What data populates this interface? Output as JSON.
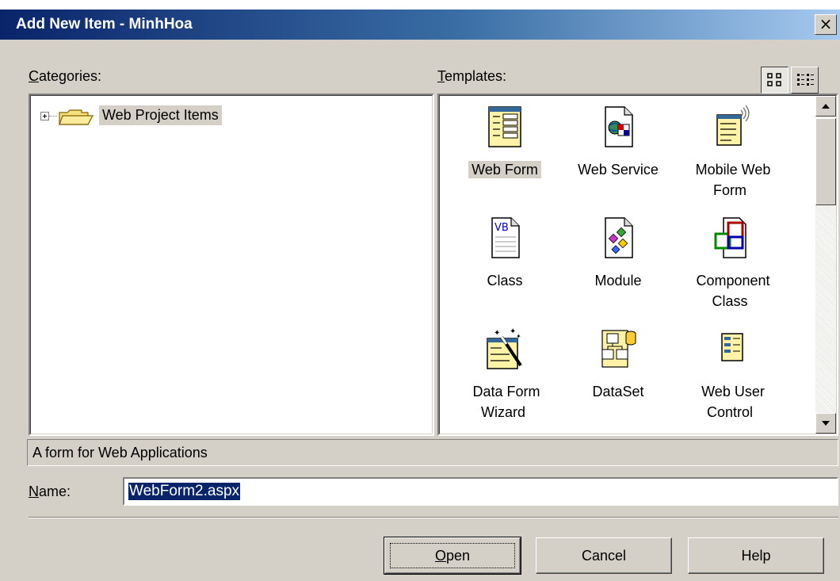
{
  "window": {
    "title": "Add New Item - MinhHoa",
    "close_glyph": "×"
  },
  "categories": {
    "label_access": "C",
    "label_rest": "ategories:",
    "tree": [
      {
        "label": "Web Project Items",
        "icon": "folder-icon"
      }
    ]
  },
  "templates": {
    "label_access": "T",
    "label_rest": "emplates:",
    "view_modes": [
      "large-icons",
      "small-icons"
    ],
    "items": [
      {
        "label": "Web Form",
        "icon": "web-form-icon",
        "selected": true
      },
      {
        "label": "Web Service",
        "icon": "web-service-icon"
      },
      {
        "label": "Mobile Web Form",
        "icon": "mobile-web-form-icon"
      },
      {
        "label": "Class",
        "icon": "class-vb-icon"
      },
      {
        "label": "Module",
        "icon": "module-icon"
      },
      {
        "label": "Component Class",
        "icon": "component-class-icon"
      },
      {
        "label": "Data Form Wizard",
        "icon": "data-form-wizard-icon"
      },
      {
        "label": "DataSet",
        "icon": "dataset-icon"
      },
      {
        "label": "Web User Control",
        "icon": "web-user-control-icon"
      }
    ]
  },
  "description": "A form for Web Applications",
  "name_field": {
    "label_access": "N",
    "label_rest": "ame:",
    "value": "WebForm2.aspx"
  },
  "buttons": {
    "open_access": "O",
    "open_rest": "pen",
    "cancel": "Cancel",
    "help": "Help"
  },
  "colors": {
    "face": "#d4d0c8",
    "title_start": "#0a246a",
    "title_end": "#a6caf0",
    "selection": "#0a246a"
  }
}
